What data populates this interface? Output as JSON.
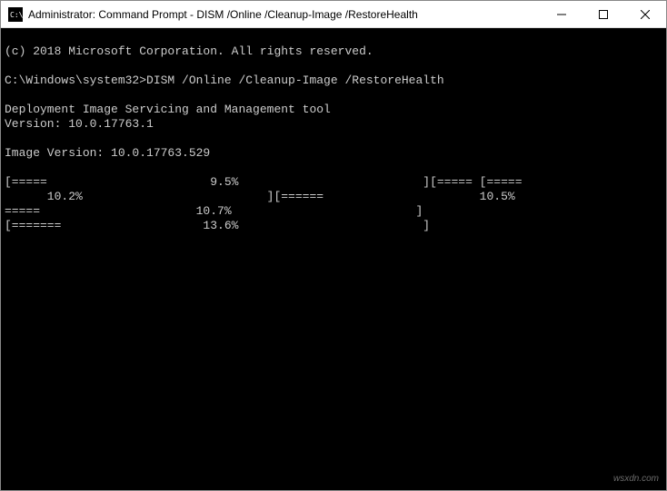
{
  "window": {
    "title": "Administrator: Command Prompt - DISM  /Online /Cleanup-Image /RestoreHealth"
  },
  "terminal": {
    "lines": [
      "(c) 2018 Microsoft Corporation. All rights reserved.",
      "",
      "C:\\Windows\\system32>DISM /Online /Cleanup-Image /RestoreHealth",
      "",
      "Deployment Image Servicing and Management tool",
      "Version: 10.0.17763.1",
      "",
      "Image Version: 10.0.17763.529",
      "",
      "[=====                       9.5%                          ][===== [=====",
      "      10.2%                          ][======                      10.5%                          [=",
      "=====                      10.7%                          ]",
      "[=======                    13.6%                          ]"
    ]
  },
  "watermark": "wsxdn.com"
}
